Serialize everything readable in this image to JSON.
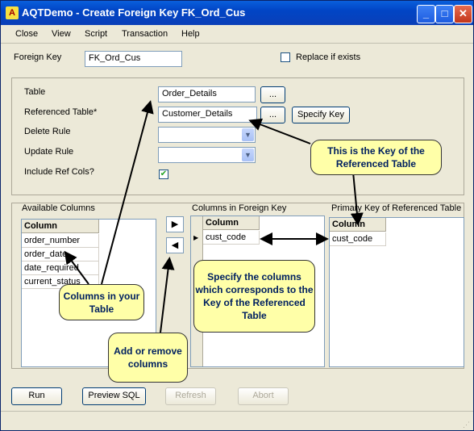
{
  "window": {
    "title": "AQTDemo - Create Foreign Key FK_Ord_Cus"
  },
  "menu": [
    "Close",
    "View",
    "Script",
    "Transaction",
    "Help"
  ],
  "fk": {
    "label": "Foreign Key",
    "value": "FK_Ord_Cus",
    "replace_label": "Replace if exists",
    "replace_checked": false
  },
  "props": {
    "table_label": "Table",
    "table_value": "Order_Details",
    "ref_label": "Referenced Table*",
    "ref_value": "Customer_Details",
    "browse_label": "...",
    "specify_key_label": "Specify Key",
    "delete_rule_label": "Delete Rule",
    "update_rule_label": "Update Rule",
    "include_ref_label": "Include Ref Cols?",
    "include_ref_checked": true
  },
  "columns": {
    "available_title": "Available Columns",
    "fk_title": "Columns in Foreign Key",
    "pk_title": "Primary Key of Referenced Table",
    "header": "Column",
    "available": [
      "order_number",
      "order_date",
      "date_required",
      "current_status"
    ],
    "fk": [
      "cust_code"
    ],
    "pk": [
      "cust_code"
    ]
  },
  "buttons": {
    "run": "Run",
    "preview": "Preview SQL",
    "refresh": "Refresh",
    "abort": "Abort"
  },
  "callouts": {
    "ref_key": "This is the Key of the Referenced Table",
    "your_table": "Columns in your Table",
    "add_remove": "Add or remove columns",
    "specify": "Specify the columns which corresponds to the Key of the Referenced Table"
  }
}
